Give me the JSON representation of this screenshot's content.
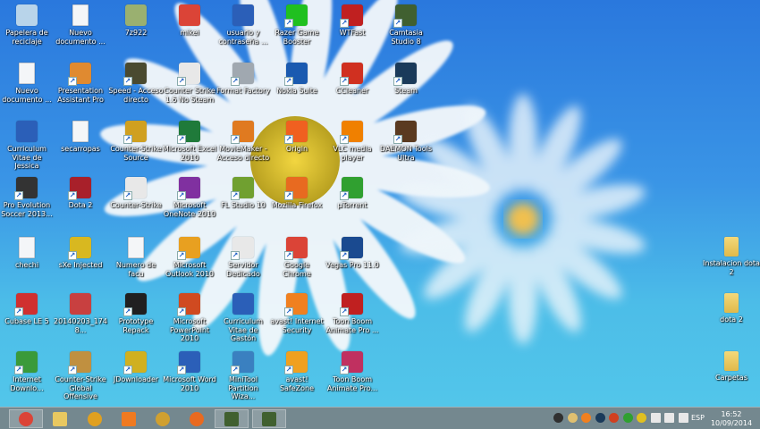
{
  "desktop": {
    "icons": [
      {
        "label": "Papelera de reciclaje",
        "icon": "recycle-bin-icon",
        "color": "#b8d4ea",
        "kind": "app",
        "shortcut": false
      },
      {
        "label": "Nuevo documento ...",
        "icon": "text-document-icon",
        "color": "#ffffff",
        "kind": "doc",
        "shortcut": false
      },
      {
        "label": "Curriculum Vitae de Jessica",
        "icon": "word-document-icon",
        "color": "#2b5fb8",
        "kind": "app",
        "shortcut": false
      },
      {
        "label": "Pro Evolution Soccer 2013...",
        "icon": "soccer-ball-icon",
        "color": "#333333",
        "kind": "app",
        "shortcut": true
      },
      {
        "label": "chechi",
        "icon": "text-document-icon",
        "color": "#ffffff",
        "kind": "doc",
        "shortcut": false
      },
      {
        "label": "Cubase LE 5",
        "icon": "cubase-icon",
        "color": "#d03030",
        "kind": "app",
        "shortcut": true
      },
      {
        "label": "Internet Downlo...",
        "icon": "internet-download-manager-icon",
        "color": "#3a9a3a",
        "kind": "app",
        "shortcut": true
      },
      {
        "label": "Nuevo documento ...",
        "icon": "text-document-icon",
        "color": "#ffffff",
        "kind": "doc",
        "shortcut": false
      },
      {
        "label": "Presentation Assistant Pro",
        "icon": "presentation-icon",
        "color": "#e08a30",
        "kind": "app",
        "shortcut": true
      },
      {
        "label": "secarropas",
        "icon": "text-document-icon",
        "color": "#ffffff",
        "kind": "doc",
        "shortcut": false
      },
      {
        "label": "Dota 2",
        "icon": "dota-icon",
        "color": "#a8202a",
        "kind": "app",
        "shortcut": true
      },
      {
        "label": "sXe Injected",
        "icon": "sxe-icon",
        "color": "#d8b820",
        "kind": "app",
        "shortcut": true
      },
      {
        "label": "20140203_1748...",
        "icon": "photo-icon",
        "color": "#c84040",
        "kind": "app",
        "shortcut": false
      },
      {
        "label": "Counter-Strike Global Offensive",
        "icon": "csgo-icon",
        "color": "#c09040",
        "kind": "app",
        "shortcut": true
      },
      {
        "label": "7z922",
        "icon": "installer-icon",
        "color": "#9ab070",
        "kind": "app",
        "shortcut": false
      },
      {
        "label": "Speed - Acceso directo",
        "icon": "speed-game-icon",
        "color": "#4a4a30",
        "kind": "app",
        "shortcut": true
      },
      {
        "label": "Counter-Strike Source",
        "icon": "counter-strike-icon",
        "color": "#d0a020",
        "kind": "app",
        "shortcut": true
      },
      {
        "label": "Counter-Strike",
        "icon": "counter-strike-icon",
        "color": "#e8e8e8",
        "kind": "app",
        "shortcut": true
      },
      {
        "label": "Numero de facu",
        "icon": "text-document-icon",
        "color": "#ffffff",
        "kind": "doc",
        "shortcut": false
      },
      {
        "label": "Prototype Repack",
        "icon": "prototype-icon",
        "color": "#202020",
        "kind": "app",
        "shortcut": true
      },
      {
        "label": "JDownloader",
        "icon": "jdownloader-icon",
        "color": "#d0b020",
        "kind": "app",
        "shortcut": true
      },
      {
        "label": "mikei",
        "icon": "chrome-icon",
        "color": "#db4437",
        "kind": "app",
        "shortcut": false
      },
      {
        "label": "Counter Strike 1.6 No Steam",
        "icon": "counter-strike-icon",
        "color": "#e8e8e8",
        "kind": "app",
        "shortcut": true
      },
      {
        "label": "Microsoft Excel 2010",
        "icon": "excel-icon",
        "color": "#1f7a3a",
        "kind": "app",
        "shortcut": true
      },
      {
        "label": "Microsoft OneNote 2010",
        "icon": "onenote-icon",
        "color": "#8030a0",
        "kind": "app",
        "shortcut": true
      },
      {
        "label": "Microsoft Outlook 2010",
        "icon": "outlook-icon",
        "color": "#e8a020",
        "kind": "app",
        "shortcut": true
      },
      {
        "label": "Microsoft PowerPoint 2010",
        "icon": "powerpoint-icon",
        "color": "#d04a20",
        "kind": "app",
        "shortcut": true
      },
      {
        "label": "Microsoft Word 2010",
        "icon": "word-icon",
        "color": "#2b5fb8",
        "kind": "app",
        "shortcut": true
      },
      {
        "label": "usuario y contraseña ...",
        "icon": "word-document-icon",
        "color": "#2b5fb8",
        "kind": "app",
        "shortcut": false
      },
      {
        "label": "Format Factory",
        "icon": "format-factory-icon",
        "color": "#a0a8b0",
        "kind": "app",
        "shortcut": true
      },
      {
        "label": "MovieMaker - Acceso directo",
        "icon": "moviemaker-icon",
        "color": "#e07a20",
        "kind": "app",
        "shortcut": true
      },
      {
        "label": "FL Studio 10",
        "icon": "fl-studio-icon",
        "color": "#70a030",
        "kind": "app",
        "shortcut": true
      },
      {
        "label": "Servidor Dedicado",
        "icon": "counter-strike-icon",
        "color": "#e8e8e8",
        "kind": "app",
        "shortcut": true
      },
      {
        "label": "Curriculum Vitae de Gastón",
        "icon": "word-document-icon",
        "color": "#2b5fb8",
        "kind": "app",
        "shortcut": false
      },
      {
        "label": "MiniTool Partition Wiza...",
        "icon": "minitool-icon",
        "color": "#3a80c0",
        "kind": "app",
        "shortcut": true
      },
      {
        "label": "Razer Game Booster",
        "icon": "razer-icon",
        "color": "#20c020",
        "kind": "app",
        "shortcut": true
      },
      {
        "label": "Nokia Suite",
        "icon": "nokia-suite-icon",
        "color": "#1a5ab0",
        "kind": "app",
        "shortcut": true
      },
      {
        "label": "Origin",
        "icon": "origin-icon",
        "color": "#f06020",
        "kind": "app",
        "shortcut": true
      },
      {
        "label": "Mozilla Firefox",
        "icon": "firefox-icon",
        "color": "#e86a20",
        "kind": "app",
        "shortcut": true
      },
      {
        "label": "Google Chrome",
        "icon": "chrome-icon",
        "color": "#db4437",
        "kind": "app",
        "shortcut": true
      },
      {
        "label": "avast! Internet Security",
        "icon": "avast-icon",
        "color": "#f08020",
        "kind": "app",
        "shortcut": true
      },
      {
        "label": "avast! SafeZone",
        "icon": "avast-safezone-icon",
        "color": "#f0a020",
        "kind": "app",
        "shortcut": true
      },
      {
        "label": "WTFast",
        "icon": "wtfast-icon",
        "color": "#c02020",
        "kind": "app",
        "shortcut": true
      },
      {
        "label": "CCleaner",
        "icon": "ccleaner-icon",
        "color": "#d03020",
        "kind": "app",
        "shortcut": true
      },
      {
        "label": "VLC media player",
        "icon": "vlc-icon",
        "color": "#f08000",
        "kind": "app",
        "shortcut": true
      },
      {
        "label": "µTorrent",
        "icon": "utorrent-icon",
        "color": "#30a030",
        "kind": "app",
        "shortcut": true
      },
      {
        "label": "Vegas Pro 11.0",
        "icon": "vegas-icon",
        "color": "#1a4a90",
        "kind": "app",
        "shortcut": true
      },
      {
        "label": "Toon Boom Animate Pro ...",
        "icon": "pdf-icon",
        "color": "#c02020",
        "kind": "app",
        "shortcut": true
      },
      {
        "label": "Toon Boom Animate Pro...",
        "icon": "toon-boom-icon",
        "color": "#c03060",
        "kind": "app",
        "shortcut": true
      },
      {
        "label": "Camtasia Studio 8",
        "icon": "camtasia-icon",
        "color": "#406030",
        "kind": "app",
        "shortcut": true
      },
      {
        "label": "Steam",
        "icon": "steam-icon",
        "color": "#1a3a5a",
        "kind": "app",
        "shortcut": true
      },
      {
        "label": "DAEMON Tools Ultra",
        "icon": "daemon-tools-icon",
        "color": "#5a3a20",
        "kind": "app",
        "shortcut": true
      }
    ],
    "right_icons": [
      {
        "label": "Instalacion dota 2",
        "icon": "folder-icon"
      },
      {
        "label": "dota 2",
        "icon": "folder-icon"
      },
      {
        "label": "Carpetas",
        "icon": "folder-icon"
      }
    ]
  },
  "taskbar": {
    "apps": [
      {
        "name": "chrome",
        "icon": "chrome-icon",
        "color": "#db4437",
        "active": true
      },
      {
        "name": "file-explorer",
        "icon": "file-explorer-icon",
        "color": "#e8c860",
        "active": false
      },
      {
        "name": "fl-studio",
        "icon": "fl-studio-icon",
        "color": "#e0a020",
        "active": false
      },
      {
        "name": "media-player",
        "icon": "media-player-icon",
        "color": "#f07a20",
        "active": false
      },
      {
        "name": "audio-app",
        "icon": "audio-app-icon",
        "color": "#d0a030",
        "active": false
      },
      {
        "name": "firefox",
        "icon": "firefox-icon",
        "color": "#e86a20",
        "active": false
      },
      {
        "name": "camtasia-studio",
        "icon": "camtasia-icon",
        "color": "#406030",
        "active": true
      },
      {
        "name": "camtasia-recorder",
        "icon": "camtasia-recorder-icon",
        "color": "#406030",
        "active": true
      }
    ],
    "tray": [
      {
        "icon": "razer-tray-icon",
        "color": "#303030"
      },
      {
        "icon": "weather-tray-icon",
        "color": "#e0c070"
      },
      {
        "icon": "avast-tray-icon",
        "color": "#f08020"
      },
      {
        "icon": "steam-tray-icon",
        "color": "#1a3a5a"
      },
      {
        "icon": "speaker-alert-tray-icon",
        "color": "#d04020"
      },
      {
        "icon": "usb-tray-icon",
        "color": "#30a030"
      },
      {
        "icon": "sxe-tray-icon",
        "color": "#e0c020"
      },
      {
        "icon": "action-center-flag-icon",
        "color": "#e8e8e8"
      },
      {
        "icon": "network-icon",
        "color": "#e8e8e8"
      },
      {
        "icon": "volume-icon",
        "color": "#e8e8e8"
      }
    ],
    "language": "ESP",
    "time": "16:52",
    "date": "10/09/2014"
  }
}
